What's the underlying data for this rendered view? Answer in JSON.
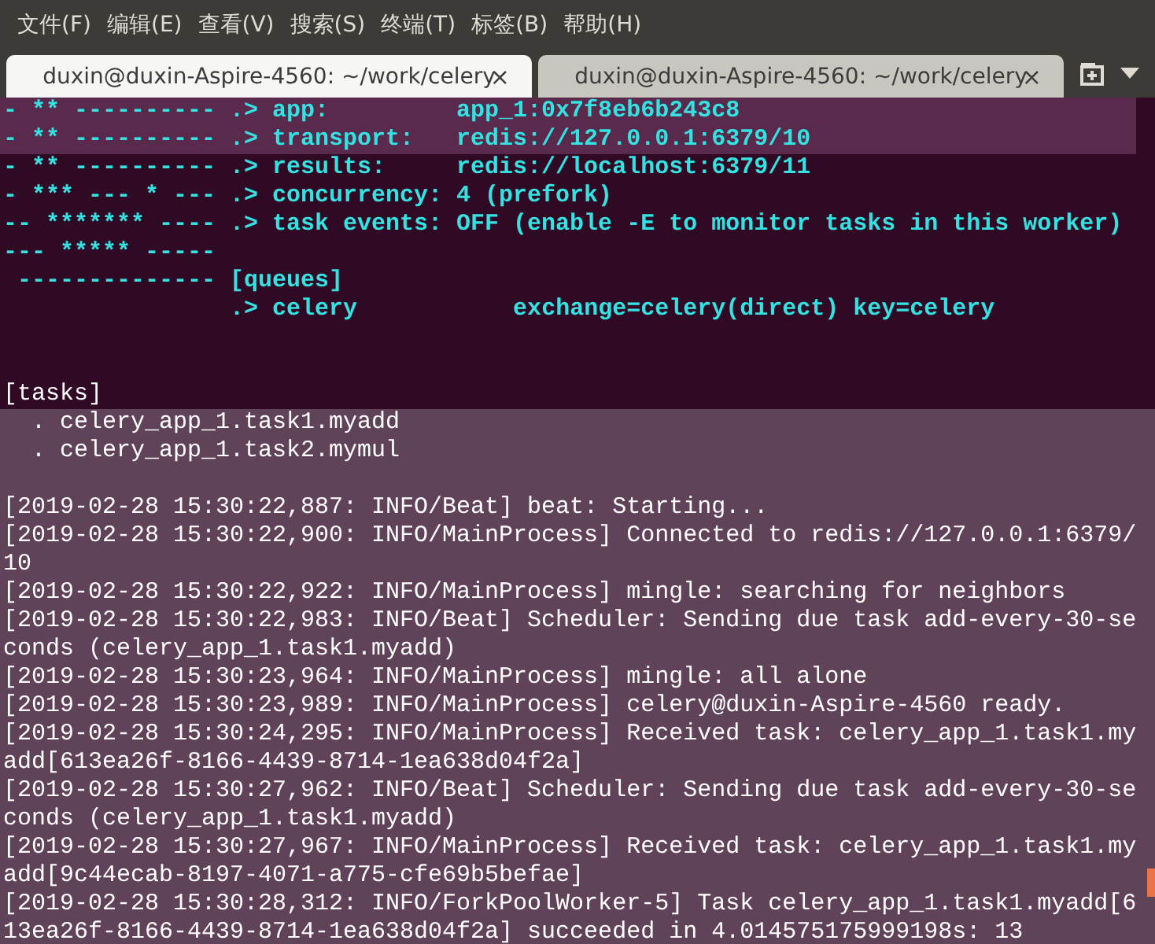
{
  "menu": [
    "文件(F)",
    "编辑(E)",
    "查看(V)",
    "搜索(S)",
    "终端(T)",
    "标签(B)",
    "帮助(H)"
  ],
  "tabs": [
    {
      "title": "duxin@duxin-Aspire-4560: ~/work/celery",
      "close": "×",
      "selected": true
    },
    {
      "title": "duxin@duxin-Aspire-4560: ~/work/celery",
      "close": "×",
      "selected": false
    }
  ],
  "terminal": {
    "lines": [
      {
        "kind": "banner",
        "text": "- ** ---------- .> app:         app_1:0x7f8eb6b243c8"
      },
      {
        "kind": "banner",
        "text": "- ** ---------- .> transport:   redis://127.0.0.1:6379/10"
      },
      {
        "kind": "banner",
        "text": "- ** ---------- .> results:     redis://localhost:6379/11"
      },
      {
        "kind": "banner",
        "text": "- *** --- * --- .> concurrency: 4 (prefork)"
      },
      {
        "kind": "banner",
        "text": "-- ******* ---- .> task events: OFF (enable -E to monitor tasks in this worker)"
      },
      {
        "kind": "banner",
        "text": "--- ***** -----"
      },
      {
        "kind": "banner",
        "text": " -------------- [queues]"
      },
      {
        "kind": "banner",
        "text": "                .> celery           exchange=celery(direct) key=celery"
      },
      {
        "kind": "blank"
      },
      {
        "kind": "blank"
      },
      {
        "kind": "plain",
        "text": "[tasks]"
      },
      {
        "kind": "plain",
        "text": "  . celery_app_1.task1.myadd"
      },
      {
        "kind": "plain",
        "text": "  . celery_app_1.task2.mymul"
      },
      {
        "kind": "blank"
      },
      {
        "kind": "plain",
        "text": "[2019-02-28 15:30:22,887: INFO/Beat] beat: Starting..."
      },
      {
        "kind": "plain",
        "text": "[2019-02-28 15:30:22,900: INFO/MainProcess] Connected to redis://127.0.0.1:6379/10"
      },
      {
        "kind": "plain",
        "text": "[2019-02-28 15:30:22,922: INFO/MainProcess] mingle: searching for neighbors"
      },
      {
        "kind": "plain",
        "text": "[2019-02-28 15:30:22,983: INFO/Beat] Scheduler: Sending due task add-every-30-seconds (celery_app_1.task1.myadd)"
      },
      {
        "kind": "plain",
        "text": "[2019-02-28 15:30:23,964: INFO/MainProcess] mingle: all alone"
      },
      {
        "kind": "plain",
        "text": "[2019-02-28 15:30:23,989: INFO/MainProcess] celery@duxin-Aspire-4560 ready."
      },
      {
        "kind": "plain",
        "text": "[2019-02-28 15:30:24,295: INFO/MainProcess] Received task: celery_app_1.task1.myadd[613ea26f-8166-4439-8714-1ea638d04f2a]"
      },
      {
        "kind": "plain",
        "text": "[2019-02-28 15:30:27,962: INFO/Beat] Scheduler: Sending due task add-every-30-seconds (celery_app_1.task1.myadd)"
      },
      {
        "kind": "plain",
        "text": "[2019-02-28 15:30:27,967: INFO/MainProcess] Received task: celery_app_1.task1.myadd[9c44ecab-8197-4071-a775-cfe69b5befae]"
      },
      {
        "kind": "plain",
        "text": "[2019-02-28 15:30:28,312: INFO/ForkPoolWorker-5] Task celery_app_1.task1.myadd[613ea26f-8166-4439-8714-1ea638d04f2a] succeeded in 4.014575175999198s: 13"
      }
    ]
  }
}
